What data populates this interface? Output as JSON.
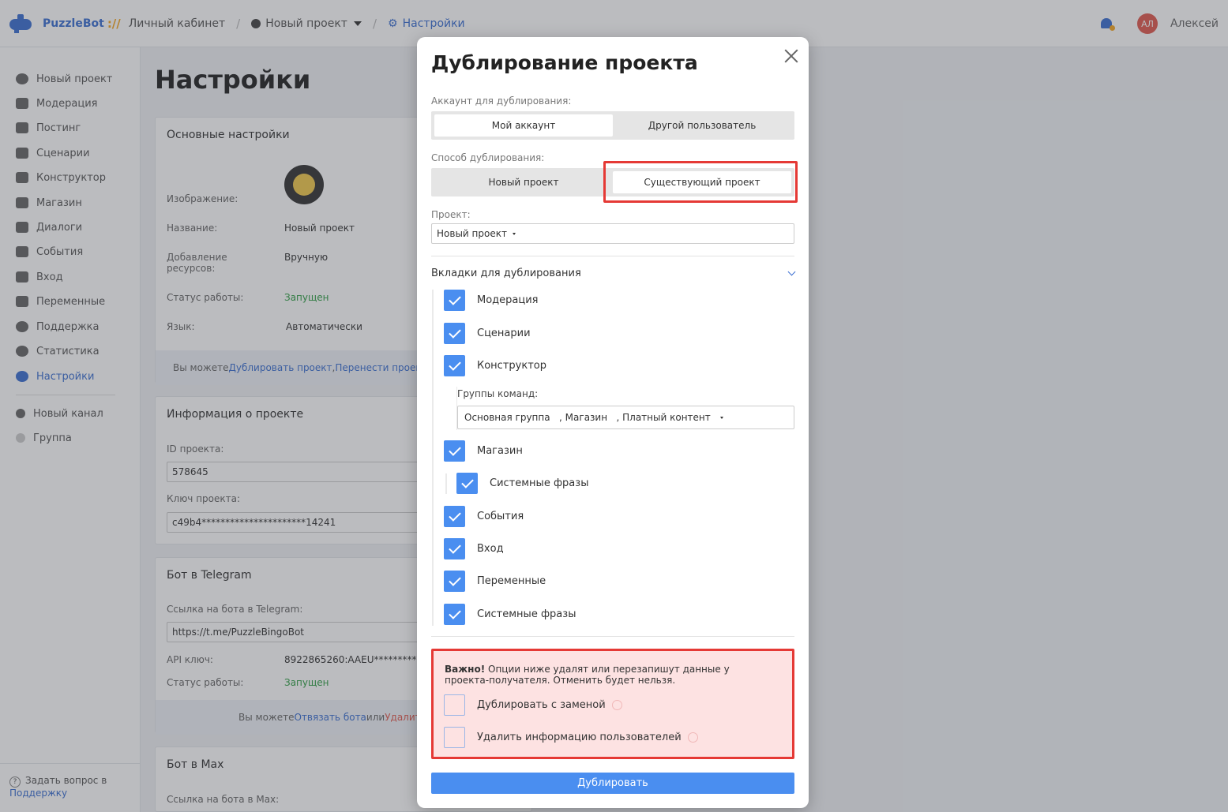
{
  "topbar": {
    "brand": "PuzzleBot",
    "brand_suffix": "://",
    "breadcrumb": [
      "Личный кабинет",
      "Новый проект",
      "Настройки"
    ],
    "user_initials": "АЛ",
    "user_name": "Алексей"
  },
  "sidebar": {
    "items": [
      "Новый проект",
      "Модерация",
      "Постинг",
      "Сценарии",
      "Конструктор",
      "Магазин",
      "Диалоги",
      "События",
      "Вход",
      "Переменные",
      "Поддержка",
      "Статистика",
      "Настройки"
    ],
    "channels": [
      "Новый канал",
      "Группа"
    ],
    "footer_text": "Задать вопрос в",
    "footer_link": "Поддержку"
  },
  "page": {
    "title": "Настройки",
    "basic": {
      "title": "Основные настройки",
      "image_label": "Изображение:",
      "name_label": "Название:",
      "name_value": "Новый проект",
      "resources_label": "Добавление ресурсов:",
      "resources_value": "Вручную",
      "status_label": "Статус работы:",
      "status_value": "Запущен",
      "lang_label": "Язык:",
      "lang_value": "Автоматически",
      "note_prefix": "Вы можете ",
      "note_link1": "Дублировать проект",
      "note_sep": ", ",
      "note_link2": "Перенести проект"
    },
    "info": {
      "title": "Информация о проекте",
      "id_label": "ID проекта:",
      "id_value": "578645",
      "key_label": "Ключ проекта:",
      "key_value": "c49b4**********************14241"
    },
    "telegram": {
      "title": "Бот в Telegram",
      "link_label": "Ссылка на бота в Telegram:",
      "link_value": "https://t.me/PuzzleBingoBot",
      "api_label": "API ключ:",
      "api_value": "8922865260:AAEU**********",
      "status_label": "Статус работы:",
      "status_value": "Запущен",
      "note_prefix": "Вы можете ",
      "note_link": "Отвязать бота",
      "note_mid": " или ",
      "note_red": "Удалить"
    },
    "max": {
      "title": "Бот в Max",
      "link_label": "Ссылка на бота в Max:"
    }
  },
  "modal": {
    "title": "Дублирование проекта",
    "account_label": "Аккаунт для дублирования:",
    "account_options": [
      "Мой аккаунт",
      "Другой пользователь"
    ],
    "method_label": "Способ дублирования:",
    "method_options": [
      "Новый проект",
      "Существующий проект"
    ],
    "project_label": "Проект:",
    "project_value": "Новый проект",
    "tabs_header": "Вкладки для дублирования",
    "tabs": [
      "Модерация",
      "Сценарии",
      "Конструктор",
      "Магазин",
      "Системные фразы",
      "События",
      "Вход",
      "Переменные",
      "Системные фразы"
    ],
    "groups_label": "Группы команд:",
    "groups_value": "Основная группа   , Магазин   , Платный контент",
    "warning_bold": "Важно!",
    "warning_text": " Опции ниже удалят или перезапишут данные у проекта-получателя. Отменить будет нельзя.",
    "option_replace": "Дублировать с заменой",
    "option_delete_users": "Удалить информацию пользователей",
    "submit": "Дублировать"
  }
}
